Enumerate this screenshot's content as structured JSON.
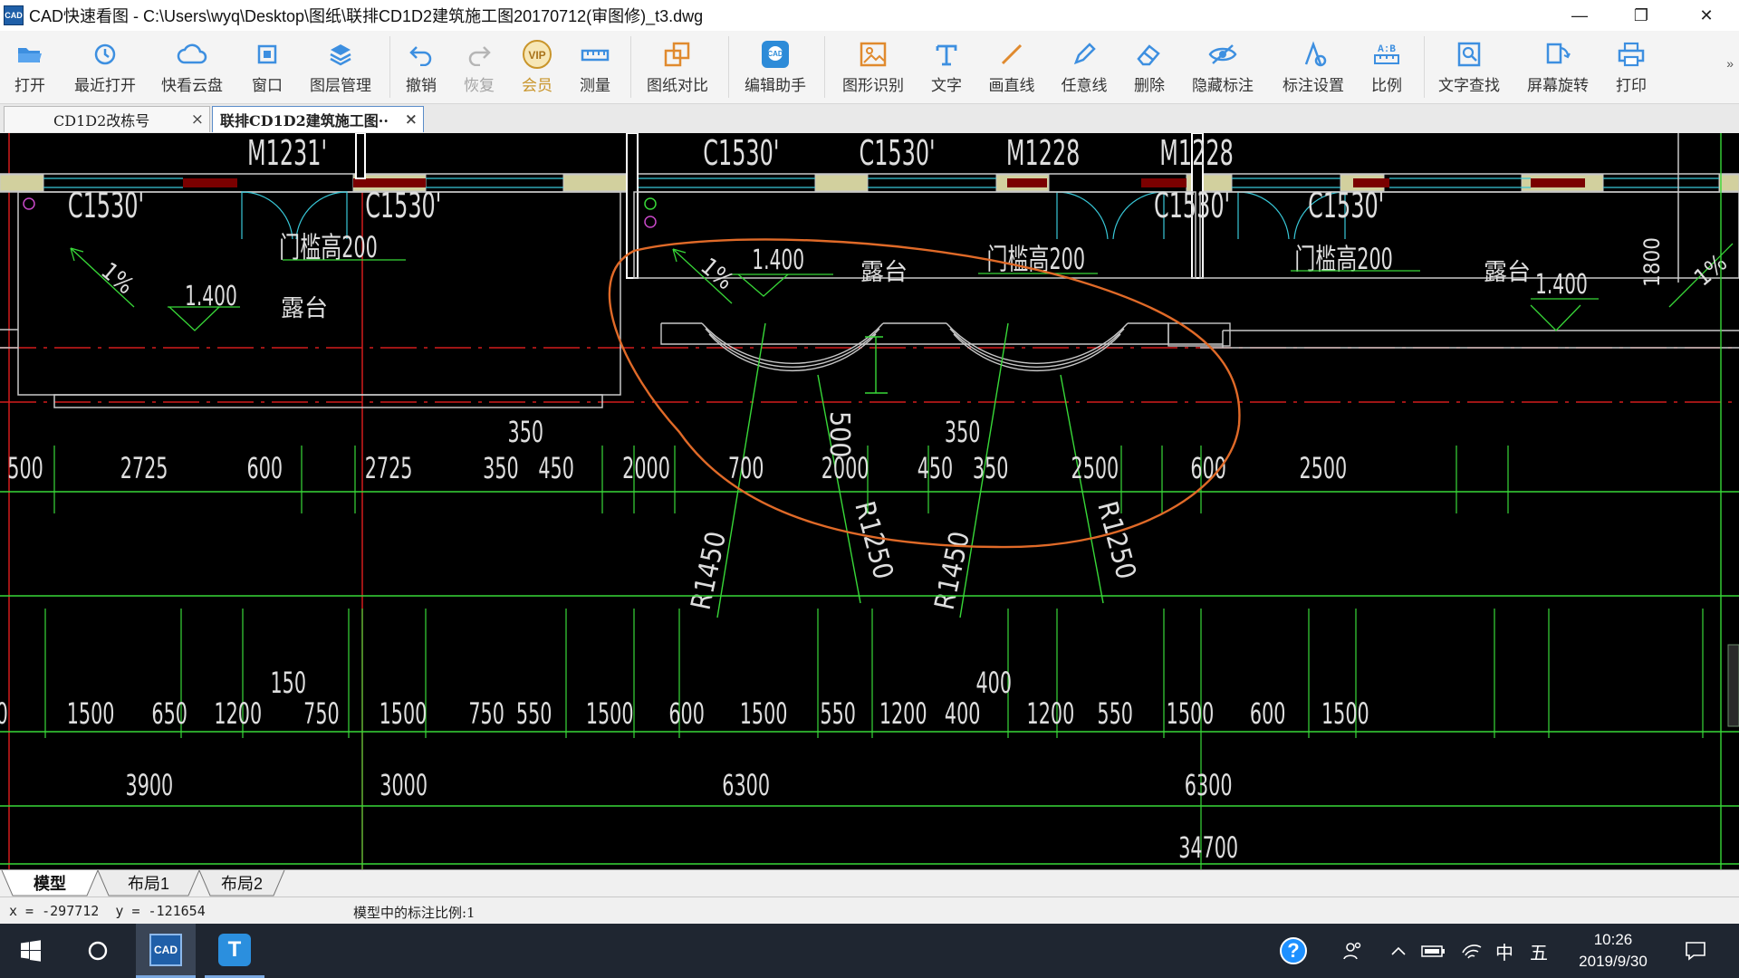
{
  "window": {
    "logo_text": "CAD",
    "title": "CAD快速看图 - C:\\Users\\wyq\\Desktop\\图纸\\联排CD1D2建筑施工图20170712(审图修)_t3.dwg",
    "min_glyph": "—",
    "max_glyph": "❐",
    "close_glyph": "✕"
  },
  "toolbar": {
    "open": "打开",
    "recent": "最近打开",
    "cloud": "快看云盘",
    "window": "窗口",
    "layers": "图层管理",
    "undo": "撤销",
    "redo": "恢复",
    "vip": "会员",
    "vip_badge": "VIP",
    "measure": "测量",
    "compare": "图纸对比",
    "assistant": "编辑助手",
    "assistant_badge": "CAD",
    "shape_recog": "图形识别",
    "text": "文字",
    "line": "画直线",
    "freeline": "任意线",
    "delete": "删除",
    "hide_dim": "隐藏标注",
    "dim_settings": "标注设置",
    "scale": "比例",
    "scale_badge": "A:B",
    "text_search": "文字查找",
    "rotate": "屏幕旋转",
    "print": "打印",
    "more": "»"
  },
  "tabs": [
    {
      "label": "CD1D2改栋号",
      "close": "×"
    },
    {
      "label": "联排CD1D2建筑施工图··",
      "close": "×"
    }
  ],
  "drawing": {
    "window_labels": [
      "M1231'",
      "C1530'",
      "C1530'",
      "M1228",
      "M1228",
      "C1530'",
      "C1530'",
      "C1530'",
      "C1530'"
    ],
    "threshold_note": "门槛高200",
    "terrace": "露台",
    "elevation": "1.400",
    "slope": "1%",
    "height_1800": "1800",
    "radius_small": "R1250",
    "radius_large": "R1450",
    "dim_350": "350",
    "dim_500": "500",
    "dim_150": "150",
    "dim_400": "400",
    "dims_row1": [
      "500",
      "2725",
      "600",
      "2725",
      "350",
      "450",
      "2000",
      "700",
      "2000",
      "450",
      "350",
      "2500",
      "600",
      "2500"
    ],
    "dims_row2": [
      "0",
      "1500",
      "650",
      "1200",
      "750",
      "1500",
      "750",
      "550",
      "1500",
      "600",
      "1500",
      "550",
      "1200",
      "400",
      "1200",
      "550",
      "1500",
      "600",
      "1500"
    ],
    "dims_row3": [
      "3900",
      "3000",
      "6300",
      "6300"
    ],
    "dim_total": "34700"
  },
  "layout_tabs": [
    "模型",
    "布局1",
    "布局2"
  ],
  "status": {
    "coords": "x = -297712  y = -121654",
    "scale_text": "模型中的标注比例:1"
  },
  "taskbar": {
    "cad_label": "CAD",
    "t_label": "T",
    "help": "?",
    "ime_lang": "中",
    "ime_mode": "五",
    "time": "10:26",
    "date": "2019/9/30"
  }
}
